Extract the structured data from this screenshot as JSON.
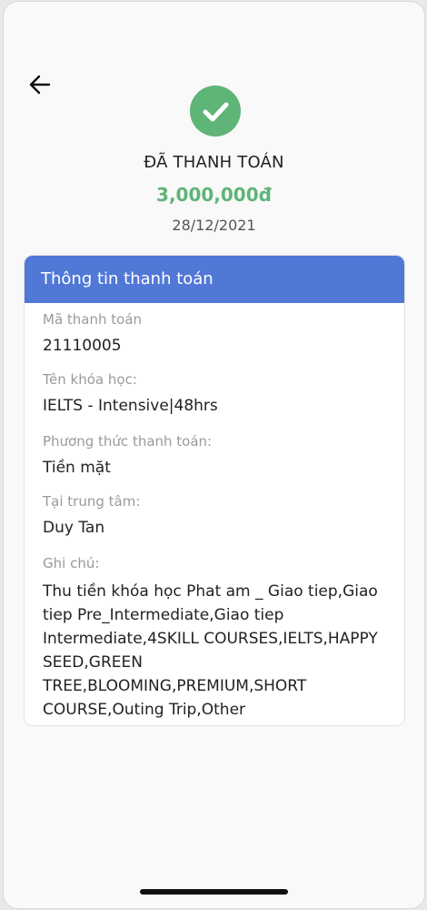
{
  "header": {
    "back_icon": "arrow-left-icon"
  },
  "status": {
    "icon": "check-icon",
    "title": "ĐÃ THANH TOÁN",
    "amount": "3,000,000đ",
    "date": "28/12/2021",
    "accent_color": "#5fb477"
  },
  "card": {
    "title": "Thông tin thanh toán",
    "header_color": "#5178d6",
    "fields": [
      {
        "label": "Mã thanh toán",
        "value": "21110005"
      },
      {
        "label": "Tên khóa học:",
        "value": "IELTS - Intensive|48hrs"
      },
      {
        "label": "Phương thức thanh toán:",
        "value": "Tiền mặt"
      },
      {
        "label": "Tại trung tâm:",
        "value": "Duy Tan"
      },
      {
        "label": "Ghi chú:",
        "value": "Thu tiền khóa học Phat am _ Giao tiep,Giao tiep Pre_Intermediate,Giao tiep Intermediate,4SKILL COURSES,IELTS,HAPPY SEED,GREEN TREE,BLOOMING,PREMIUM,SHORT COURSE,Outing Trip,Other"
      }
    ]
  }
}
